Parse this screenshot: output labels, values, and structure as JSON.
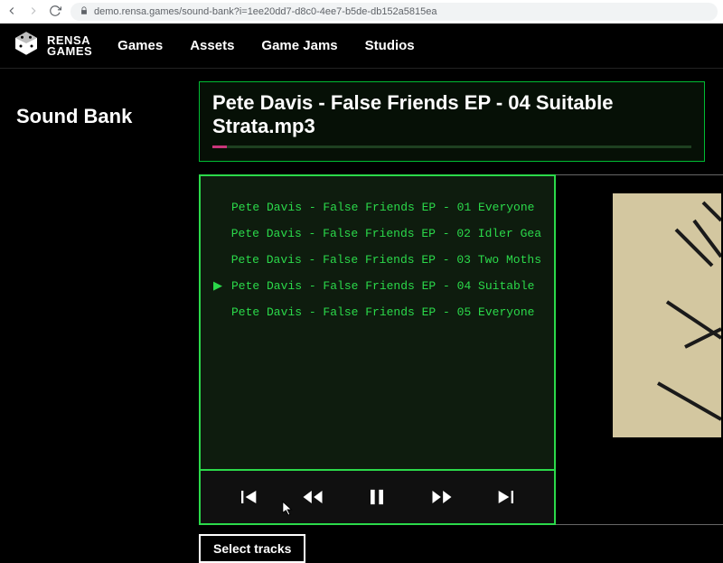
{
  "browser": {
    "url": "demo.rensa.games/sound-bank?i=1ee20dd7-d8c0-4ee7-b5de-db152a5815ea"
  },
  "brand": {
    "line1": "RENSA",
    "line2": "GAMES"
  },
  "nav": {
    "items": [
      "Games",
      "Assets",
      "Game Jams",
      "Studios"
    ]
  },
  "sidebar": {
    "title": "Sound Bank"
  },
  "player": {
    "now_playing": "Pete Davis - False Friends EP - 04 Suitable Strata.mp3",
    "progress_percent": 3,
    "current_index": 3,
    "tracks": [
      "Pete Davis - False Friends EP - 01 Everyone",
      "Pete Davis - False Friends EP - 02 Idler Gea",
      "Pete Davis - False Friends EP - 03 Two Moths",
      "Pete Davis - False Friends EP - 04 Suitable",
      "Pete Davis - False Friends EP - 05 Everyone"
    ],
    "select_tracks_label": "Select tracks"
  },
  "colors": {
    "accent_green": "#2bd94a",
    "progress": "#c9367a",
    "panel_bg": "#0e1c0e"
  }
}
